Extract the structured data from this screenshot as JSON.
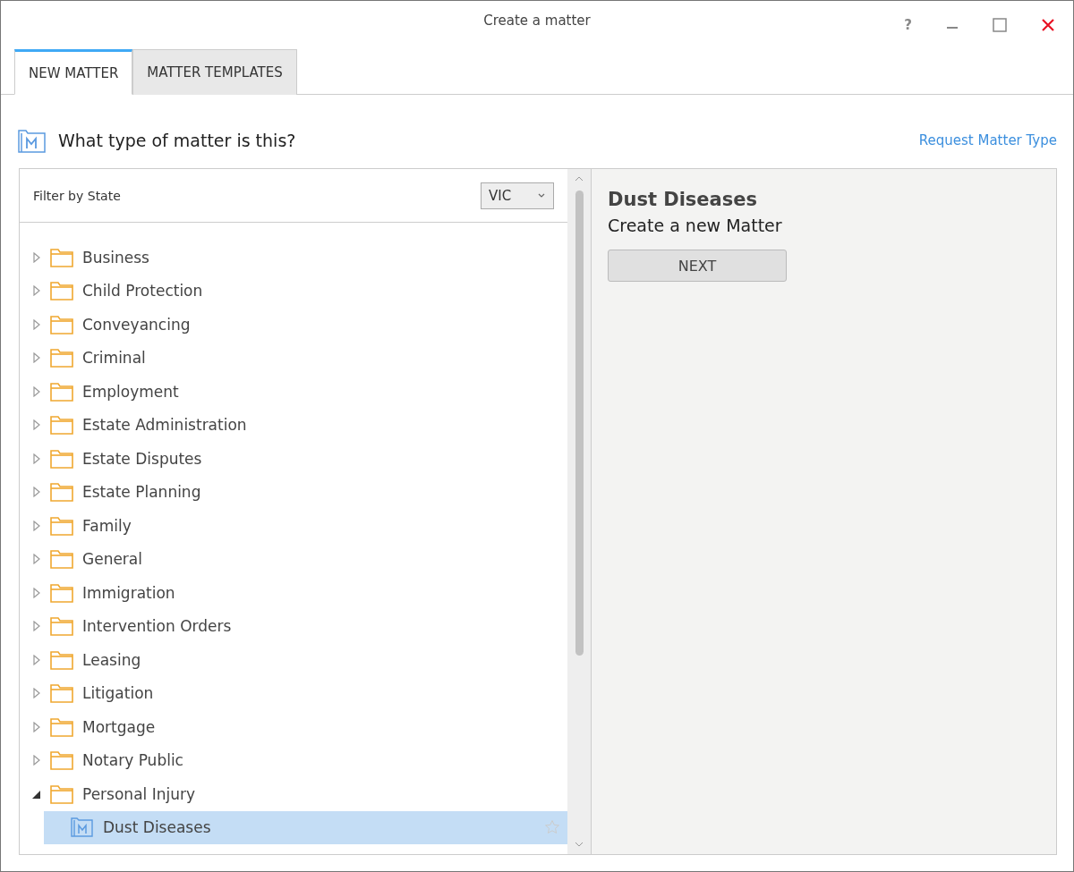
{
  "window": {
    "title": "Create a matter",
    "controls": [
      "?"
    ]
  },
  "tabs": [
    {
      "label": "NEW MATTER",
      "selected": true
    },
    {
      "label": "MATTER TEMPLATES",
      "selected": false
    }
  ],
  "heading": "What type of matter is this?",
  "request_link": "Request Matter Type",
  "filter": {
    "label": "Filter by State",
    "value": "VIC"
  },
  "tree": [
    {
      "label": "Business",
      "expanded": false
    },
    {
      "label": "Child Protection",
      "expanded": false
    },
    {
      "label": "Conveyancing",
      "expanded": false
    },
    {
      "label": "Criminal",
      "expanded": false
    },
    {
      "label": "Employment",
      "expanded": false
    },
    {
      "label": "Estate Administration",
      "expanded": false
    },
    {
      "label": "Estate Disputes",
      "expanded": false
    },
    {
      "label": "Estate Planning",
      "expanded": false
    },
    {
      "label": "Family",
      "expanded": false
    },
    {
      "label": "General",
      "expanded": false
    },
    {
      "label": "Immigration",
      "expanded": false
    },
    {
      "label": "Intervention Orders",
      "expanded": false
    },
    {
      "label": "Leasing",
      "expanded": false
    },
    {
      "label": "Litigation",
      "expanded": false
    },
    {
      "label": "Mortgage",
      "expanded": false
    },
    {
      "label": "Notary Public",
      "expanded": false
    },
    {
      "label": "Personal Injury",
      "expanded": true,
      "children": [
        {
          "label": "Dust Diseases",
          "selected": true
        }
      ]
    }
  ],
  "detail": {
    "title": "Dust Diseases",
    "subtitle": "Create a new Matter",
    "button": "NEXT"
  }
}
